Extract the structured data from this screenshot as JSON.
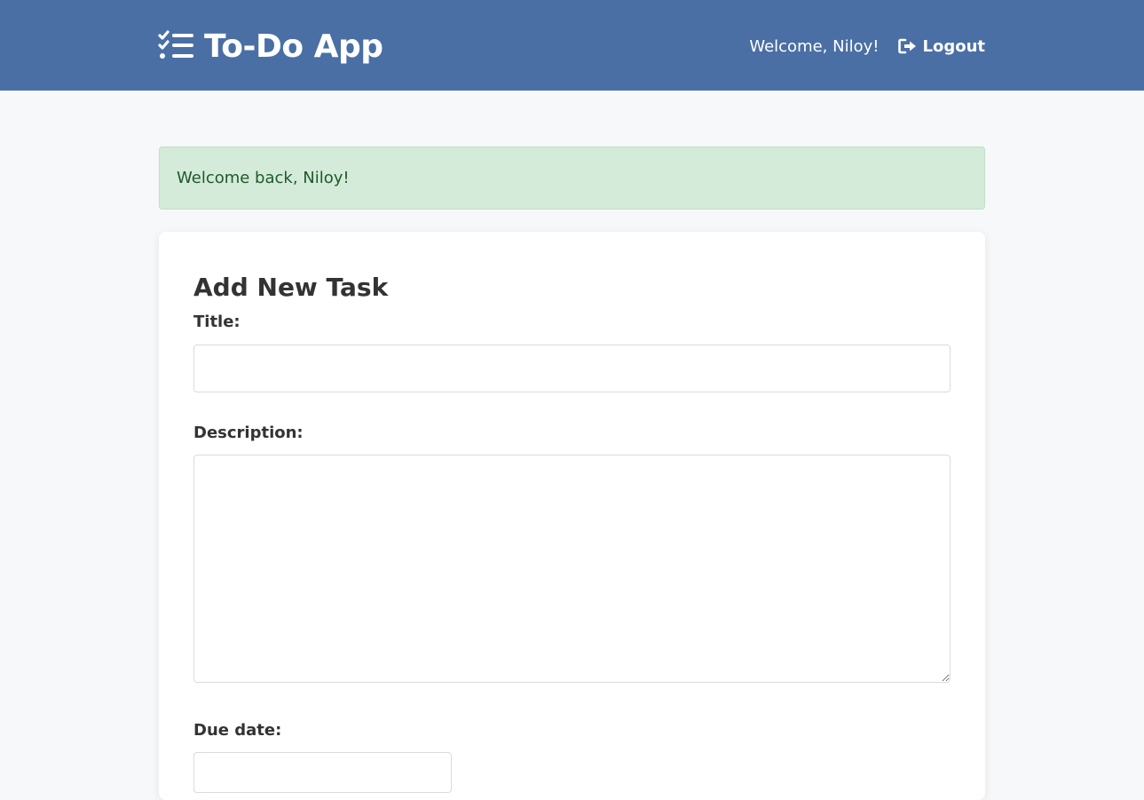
{
  "header": {
    "brand_icon": "list-check-icon",
    "title": "To-Do App",
    "welcome": "Welcome, Niloy!",
    "logout_icon": "sign-out-icon",
    "logout_label": "Logout",
    "background_color": "#4a6fa5"
  },
  "flash": {
    "message": "Welcome back, Niloy!",
    "background_color": "#d4ebd9",
    "text_color": "#1f5a2b"
  },
  "form": {
    "heading": "Add New Task",
    "title_label": "Title:",
    "title_value": "",
    "description_label": "Description:",
    "description_value": "",
    "due_date_label": "Due date:",
    "due_date_value": ""
  }
}
